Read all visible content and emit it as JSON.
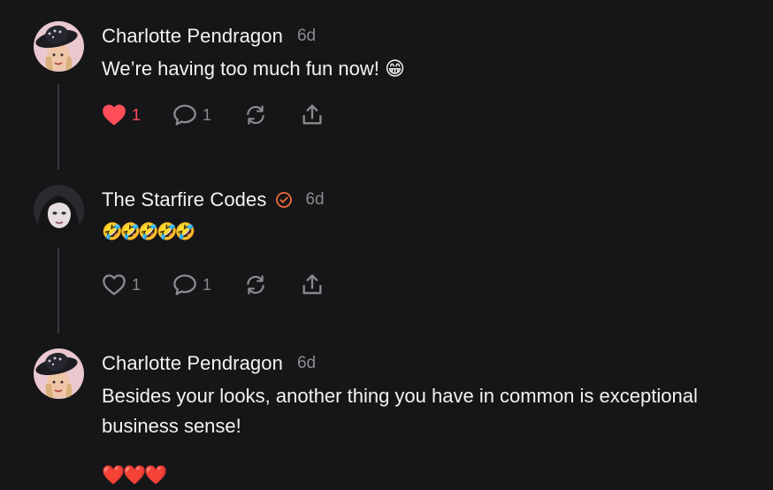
{
  "posts": [
    {
      "author": "Charlotte Pendragon",
      "time": "6d",
      "text": "We’re having too much fun now! 😁",
      "likes": "1",
      "replies": "1",
      "liked": true
    },
    {
      "author": "The Starfire Codes",
      "time": "6d",
      "verified": true,
      "text": "🤣🤣🤣🤣🤣",
      "likes": "1",
      "replies": "1",
      "liked": false
    },
    {
      "author": "Charlotte Pendragon",
      "time": "6d",
      "text": "Besides your looks, another thing you have in common is exceptional business sense!",
      "hearts": "❤️❤️❤️"
    }
  ],
  "colors": {
    "background": "#161618",
    "like_active": "#ff4d5a",
    "verified": "#f26b3a",
    "muted": "#8a8a8f"
  },
  "icons": {
    "like": "heart-icon",
    "reply": "comment-icon",
    "repost": "repost-icon",
    "share": "share-icon",
    "verified": "verified-badge-icon"
  }
}
